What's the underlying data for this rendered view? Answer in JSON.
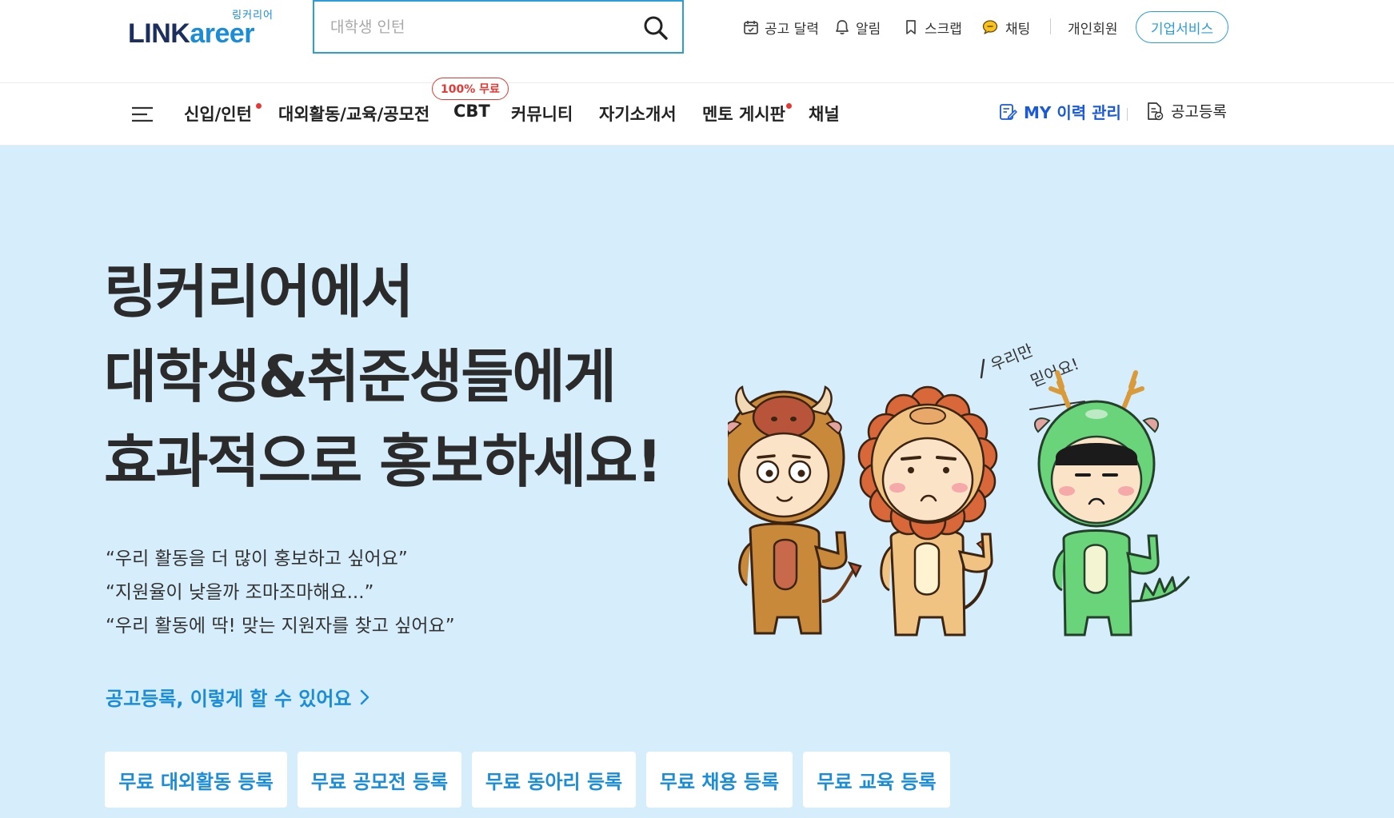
{
  "header": {
    "logo_sub": "링커리어",
    "logo_part1": "LINK",
    "logo_part2": "areer",
    "search_placeholder": "대학생 인턴",
    "utils": [
      {
        "label": "공고 달력",
        "icon": "calendar-icon"
      },
      {
        "label": "알림",
        "icon": "bell-icon"
      },
      {
        "label": "스크랩",
        "icon": "bookmark-icon"
      },
      {
        "label": "채팅",
        "icon": "chat-icon"
      }
    ],
    "personal_member": "개인회원",
    "business_service": "기업서비스"
  },
  "nav": {
    "items": [
      {
        "label": "신입/인턴",
        "new_dot": true
      },
      {
        "label": "대외활동/교육/공모전",
        "new_dot": false
      },
      {
        "label": "CBT",
        "new_dot": false
      },
      {
        "label": "커뮤니티",
        "new_dot": false
      },
      {
        "label": "자기소개서",
        "new_dot": false
      },
      {
        "label": "멘토 게시판",
        "new_dot": true
      },
      {
        "label": "채널",
        "new_dot": false
      }
    ],
    "cbt_badge": "100% 무료",
    "my_resume": "MY 이력 관리",
    "post_job": "공고등록"
  },
  "hero": {
    "headline": [
      "링커리어에서",
      "대학생&취준생들에게",
      "효과적으로 홍보하세요!"
    ],
    "quotes": [
      "“우리 활동을 더 많이 홍보하고 싶어요”",
      "“지원율이 낮을까 조마조마해요...”",
      "“우리 활동에 딱! 맞는 지원자를 찾고 싶어요”"
    ],
    "how_link": "공고등록, 이렇게 할 수 있어요",
    "speech": [
      "우리만",
      "믿어요!"
    ],
    "register_buttons": [
      "무료 대외활동 등록",
      "무료 공모전 등록",
      "무료 동아리 등록",
      "무료 채용 등록",
      "무료 교육 등록"
    ]
  },
  "colors": {
    "brand_blue": "#1a8cd8",
    "brand_navy": "#1b2e5e",
    "hero_bg": "#d6edfb",
    "alert_red": "#e53935",
    "resume_blue": "#1a5ad8"
  }
}
